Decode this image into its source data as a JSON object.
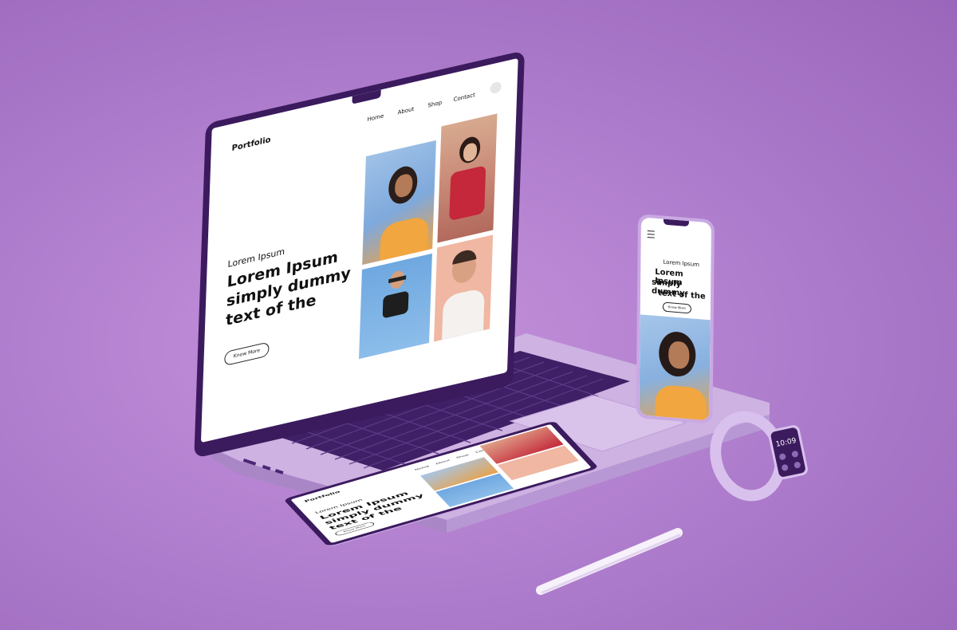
{
  "colors": {
    "background": "#b07fce",
    "device_body": "#d8bfe8",
    "bezel": "#3b1a5e",
    "keyboard": "#4a2773",
    "screen": "#ffffff"
  },
  "laptop": {
    "logo": "Portfolio",
    "nav": [
      "Home",
      "About",
      "Shop",
      "Contact"
    ],
    "hero": {
      "kicker": "Lorem Ipsum",
      "headline_lines": [
        "Lorem Ipsum",
        "simply dummy",
        "text of the"
      ],
      "button": "Know More"
    },
    "photos": [
      "woman-curly-hair-yellow-top",
      "woman-red-scarf",
      "man-smiling-white-sweater",
      "woman-sunglasses-sky"
    ]
  },
  "phone": {
    "menu_icon": "hamburger-icon",
    "hero": {
      "kicker": "Lorem Ipsum",
      "headline_lines": [
        "Lorem Ipsum",
        "simply dummy",
        "text of the"
      ],
      "button": "Know More"
    },
    "photo": "woman-curly-hair-yellow-top"
  },
  "tablet": {
    "logo": "Portfolio",
    "nav": [
      "Home",
      "About",
      "Shop",
      "Contact"
    ],
    "hero": {
      "kicker": "Lorem Ipsum",
      "headline_lines": [
        "Lorem Ipsum",
        "simply dummy",
        "text of the"
      ],
      "button": "Know More"
    }
  },
  "watch": {
    "time": "10:09"
  }
}
